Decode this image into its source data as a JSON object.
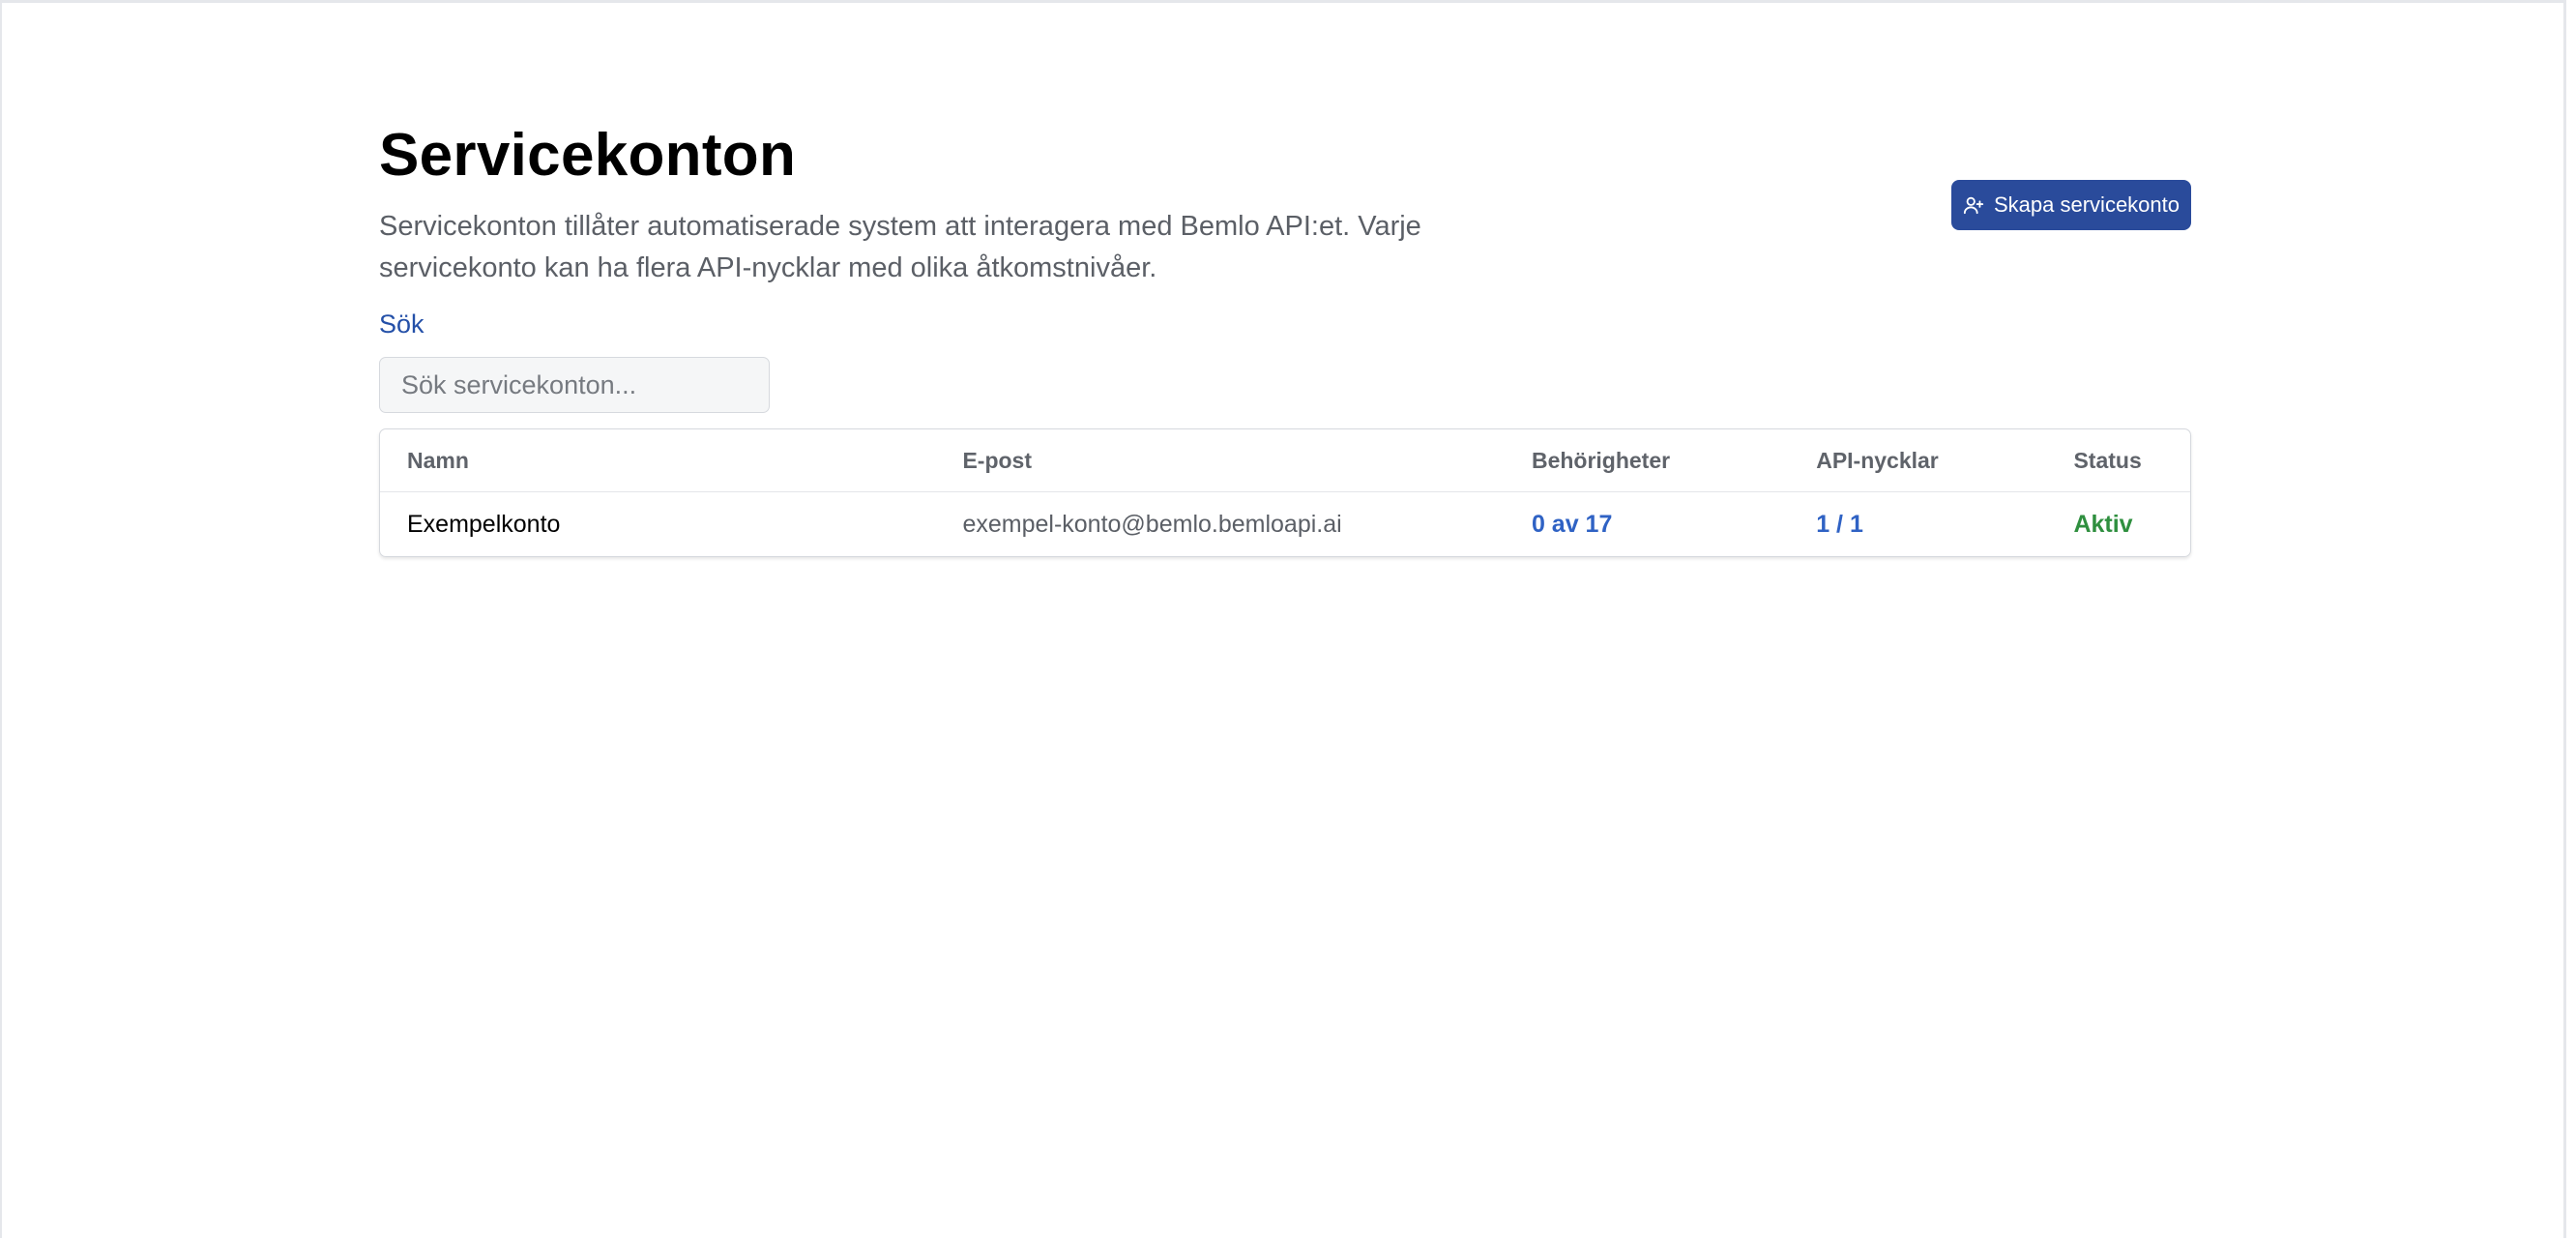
{
  "page": {
    "title": "Servicekonton",
    "description": "Servicekonton tillåter automatiserade system att interagera med Bemlo API:et. Varje servicekonto kan ha flera API-nycklar med olika åtkomstnivåer."
  },
  "actions": {
    "create_label": "Skapa servicekonto",
    "create_icon": "user-plus-icon"
  },
  "search": {
    "label": "Sök",
    "placeholder": "Sök servicekonton...",
    "value": ""
  },
  "table": {
    "columns": [
      "Namn",
      "E-post",
      "Behörigheter",
      "API-nycklar",
      "Status"
    ],
    "rows": [
      {
        "name": "Exempelkonto",
        "email": "exempel-konto@bemlo.bemloapi.ai",
        "permissions": "0 av 17",
        "api_keys": "1 / 1",
        "status": "Aktiv"
      }
    ]
  },
  "colors": {
    "primary": "#2a4b9b",
    "link": "#2f62c4",
    "status_active": "#2f8f3f",
    "label_link": "#2450a8"
  }
}
